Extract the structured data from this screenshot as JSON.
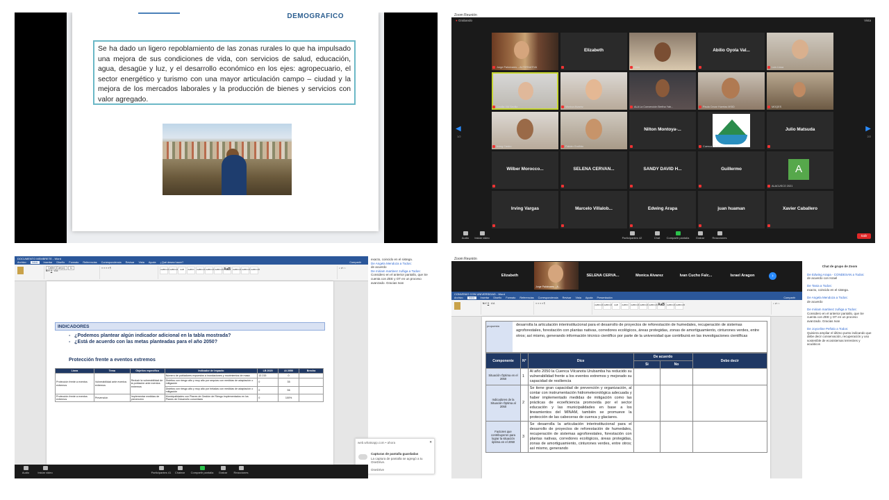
{
  "tl": {
    "heading": "DEMOGRÁFICO",
    "quote": "Se ha dado un ligero repoblamiento de las zonas rurales lo que ha impulsado una mejora de sus condiciones de vida, con servicios de salud, educación, agua, desagüe y luz, y el desarrollo económico en los ejes: agropecuario, el sector energético y turismo con una mayor articulación campo – ciudad y la mejora de los mercados laborales y la producción de bienes y servicios con valor agregado."
  },
  "tr": {
    "window_title": "Zoom Reunión",
    "recording": "Grabando",
    "view_label": "Vista",
    "tiles": [
      {
        "name": "",
        "label": "Jorge Paliolvares – ALTERNATIVA"
      },
      {
        "name": "Elizabeth",
        "label": ""
      },
      {
        "name": "",
        "label": "Vidal"
      },
      {
        "name": "Abilio Oyola Val...",
        "label": ""
      },
      {
        "name": "",
        "label": "Luis Llosa"
      },
      {
        "name": "",
        "label": "Cecilia VM Sevilla"
      },
      {
        "name": "",
        "label": "Monica Alvarez"
      },
      {
        "name": "",
        "label": "ALA La Convención Bertha Yab..."
      },
      {
        "name": "",
        "label": "Paula Cecar Huertas MSID"
      },
      {
        "name": "",
        "label": "MOQES"
      },
      {
        "name": "",
        "label": "Irving Castro"
      },
      {
        "name": "",
        "label": "Fabián Gruñido"
      },
      {
        "name": "Nilton Montoya-...",
        "label": ""
      },
      {
        "name": "",
        "label": "Cuenca Vilcanota Urubamba"
      },
      {
        "name": "Julio Matsuda",
        "label": ""
      },
      {
        "name": "Wilber Morocco...",
        "label": ""
      },
      {
        "name": "SELENA CERVAN...",
        "label": ""
      },
      {
        "name": "SANDY DAVID H...",
        "label": ""
      },
      {
        "name": "Guillermo",
        "label": ""
      },
      {
        "name": "",
        "label": "ALACUSCO 2021",
        "avatar": "A"
      },
      {
        "name": "Irving Vargas",
        "label": ""
      },
      {
        "name": "Marcelo Villalob...",
        "label": ""
      },
      {
        "name": "Edwing Arapa",
        "label": ""
      },
      {
        "name": "juan huaman",
        "label": ""
      },
      {
        "name": "Xavier Caballero",
        "label": ""
      }
    ],
    "page_left": "1/2",
    "page_right": "2/2",
    "toolbar": {
      "audio": "Audio",
      "video": "Iniciar video",
      "participants": "Participantes",
      "participants_count": "42",
      "chat": "Chat",
      "share": "Compartir pantalla",
      "record": "Grabar",
      "reactions": "Reacciones",
      "leave": "Salir"
    }
  },
  "bl": {
    "word_title": "DOCUMENTO MEMBRETE - Word",
    "menu": [
      "Archivo",
      "Inicio",
      "Insertar",
      "Diseño",
      "Formato",
      "Referencias",
      "Correspondencia",
      "Revisar",
      "Vista",
      "Ayuda",
      "¿Qué desea hacer?"
    ],
    "share": "Compartir",
    "font": "Calibri (Cuerpo)",
    "size": "11",
    "styles": [
      "AaBbCcDd",
      "AaBbCcDd",
      "AaB",
      "AaBbC",
      "AaBbCcD",
      "AaBbCcD",
      "AaBbCcD",
      "AaB",
      "AaBbCcD",
      "AaBbCcD",
      "AaBbCcD"
    ],
    "section": "INDICADORES",
    "q1": "¿Podemos plantear algún indicador adicional en la tabla mostrada?",
    "q2": "¿Está de acuerdo con las metas planteadas para el año 2050?",
    "protection": "Protección frente a eventos extremos",
    "table_headers": [
      "Línea",
      "Tema",
      "Objetivo específico",
      "Indicador de impacto",
      "LB 2020",
      "Al 2050",
      "Brecha"
    ],
    "rows": [
      {
        "linea": "Protección frente a eventos extremos",
        "tema": "Vulnerabilidad ante eventos extremos",
        "obj": "Reducir la vulnerabilidad de la población ante eventos extremos",
        "ind": "Número de pobladores expuestos a inundaciones y movimientos de masa",
        "lb": "13 215",
        "al": "0"
      },
      {
        "ind": "Distritos con riesgo alto y muy alto por sequías con medidas de adaptación o mitigación",
        "lb": "0",
        "al": "35"
      },
      {
        "ind": "Distritos con riesgo alto y muy alto por heladas con medidas de adaptación o mitigación",
        "lb": "0",
        "al": "56"
      },
      {
        "linea": "Protección frente a eventos extremos",
        "tema": "Prevención",
        "obj": "Implementar medidas de prevención",
        "ind": "Municipalidades con Planes de Gestión de Riesgo implementados en los Planes de Desarrollo concertado",
        "lb": "0",
        "al": "100%"
      }
    ],
    "chat": [
      {
        "text": "exacto, coincido en el sistega."
      },
      {
        "from": "De Angela Mendoza a Todos:",
        "text": "de acuerdo"
      },
      {
        "from": "De miriam martinez zuñiga a Todos:",
        "text": "Considero en el anterior pantallo, que Se cuenta con ZEE y OT en un proceso avanzado. Gracias Ivan"
      }
    ],
    "notif": {
      "source": "web.whatsapp.com • ahora",
      "title": "Capturas de pantalla guardadas",
      "msg": "La captura de pantalla se agregó a tu OneDrive.",
      "app": "OneDrive"
    },
    "toolbar": {
      "audio": "Audio",
      "video": "Iniciar video",
      "participants": "Participantes",
      "count": "41",
      "chat": "Chatear",
      "share": "Compartir pantalla",
      "record": "Grabar",
      "reactions": "Reacciones"
    }
  },
  "br": {
    "window_title": "Zoom Reunión",
    "strip": [
      "Elizabeth",
      "",
      "SELENA CERVA...",
      "Monica Alvarez",
      "Ivan Cucho Falc...",
      "Israel Aragon"
    ],
    "strip_label": "Jorge Paliolvares – A...",
    "word_title": "CONVENIO CON UNIVERSIDAD - Word",
    "menu": [
      "Archivo",
      "Inicio",
      "Insertar",
      "Diseño",
      "Formato",
      "Referencias",
      "Correspondencia",
      "Revisar",
      "Vista",
      "Ayuda",
      "Presentación"
    ],
    "share": "Compartir",
    "prop_side": "propuesta",
    "prop_text": "desarrolla la articulación interinstitucional para el desarrollo de proyectos de reforestación de humedales, recuperación de sistemas agroforestales, forestación con plantas nativas, corredores ecológicos, áreas protegidas, zonas de amortiguamiento, cinturones verdes, entre otros; así mismo, generando información técnico científico por parte de la universidad que contribuirá en las investigaciones científicas",
    "headers": [
      "Componente",
      "N°",
      "Dice",
      "De acuerdo",
      "Debo decir"
    ],
    "sub_si": "Si",
    "sub_no": "No",
    "rows": [
      {
        "comp": "Situación Óptima en el 2050",
        "n": "1",
        "dice": "Al año 2050 la Cuenca Vilcanota Urubamba ha reducido su vulnerabilidad frente a los eventos extremos y mejorado su capacidad de resiliencia"
      },
      {
        "comp": "Indicadores de la Situación Óptima al 2050",
        "n": "2",
        "dice": "Se tiene gran capacidad de prevención y organización, al contar con instrumentación hidrometeorológica adecuada y haber implementado medidas de mitigación como las prácticas de ecoeficiencia promovida por el sector educación y las municipalidades en base a los lineamientos del MINAM, también se promueve la protección de las cabeceras de cuenca y glaciares."
      },
      {
        "comp": "Factores que contribuyeron para lograr la situación óptima en el 2050",
        "n": "3",
        "dice": "Se desarrolla la articulación interinstitucional para el desarrollo de proyectos de reforestación de humedales, recuperación de sistemas agroforestales, forestación con plantas nativas, corredores ecológicos, áreas protegidas, zonas de amortiguamiento, cinturones verdes, entre otros; así mismo, generando"
      }
    ],
    "chat_title": "Chat de grupo de Zoom",
    "chat": [
      {
        "from": "De Edwing Arapa - CONDESAN a Todos:",
        "text": "de acuerdo con Israel"
      },
      {
        "from": "De Tania a Todos:",
        "text": "exacto, coincido en el sistega."
      },
      {
        "from": "De Angela Mendoza a Todos:",
        "text": "de acuerdo"
      },
      {
        "from": "De miriam martinez zuñiga a Todos:",
        "text": "Considero en el anterior pantallo, que Se cuenta con ZEE y OT en un proceso avanzado. Gracias Ivan"
      },
      {
        "from": "De Joyceline Peñalo a Todos:",
        "text": "Quisiera ampliar el último punto indicando que debe decir conservación, recuperación y uso sostenible de ecosistemas terrestres y acuáticos"
      }
    ]
  }
}
